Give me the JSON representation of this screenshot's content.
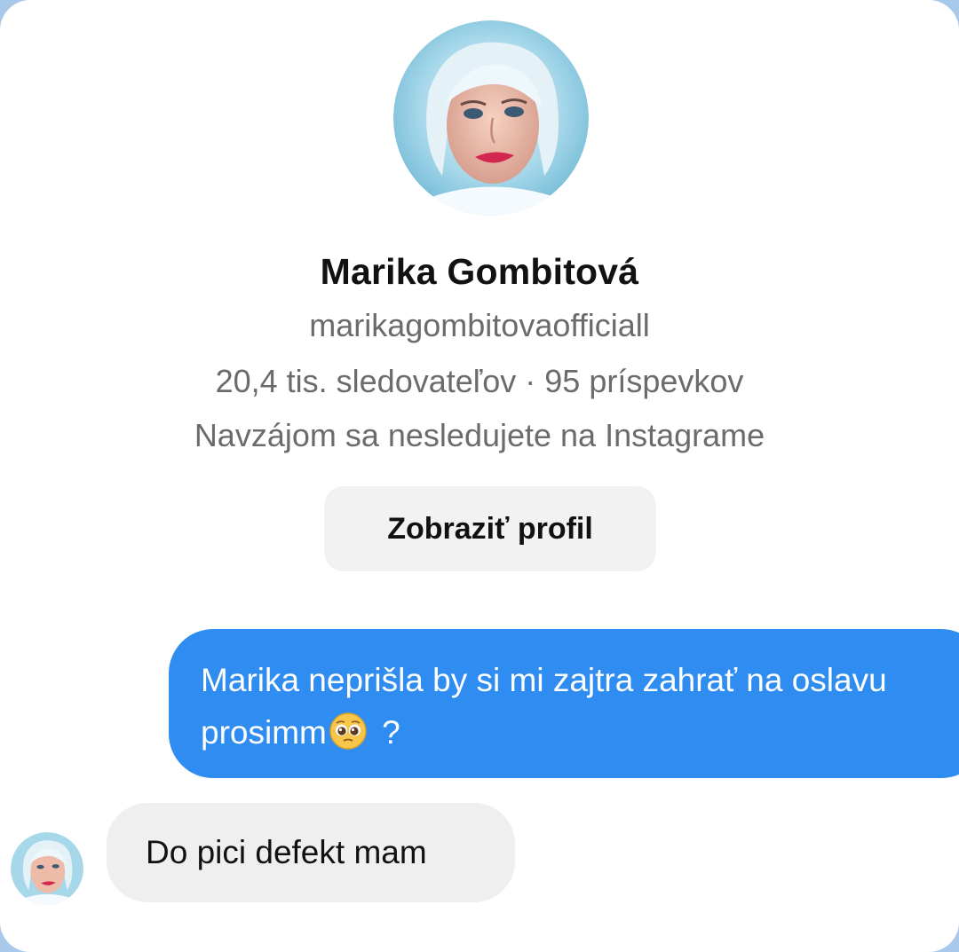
{
  "profile": {
    "name": "Marika Gombitová",
    "username": "marikagombitovaofficiall",
    "stats": "20,4 tis. sledovateľov · 95 príspevkov",
    "mutual_status": "Navzájom sa nesledujete na Instagrame",
    "view_profile_label": "Zobraziť profil"
  },
  "messages": {
    "sent": {
      "text_before_emoji": "Marika neprišla by si mi zajtra zahrať na oslavu prosimm",
      "emoji": "pleading-face-emoji",
      "text_after_emoji": " ?"
    },
    "received": {
      "text": "Do pici defekt mam"
    }
  },
  "colors": {
    "sent_bubble": "#2f8cf0",
    "received_bubble": "#efefef",
    "button_bg": "#f2f2f3",
    "secondary_text": "#6b6b6b"
  }
}
